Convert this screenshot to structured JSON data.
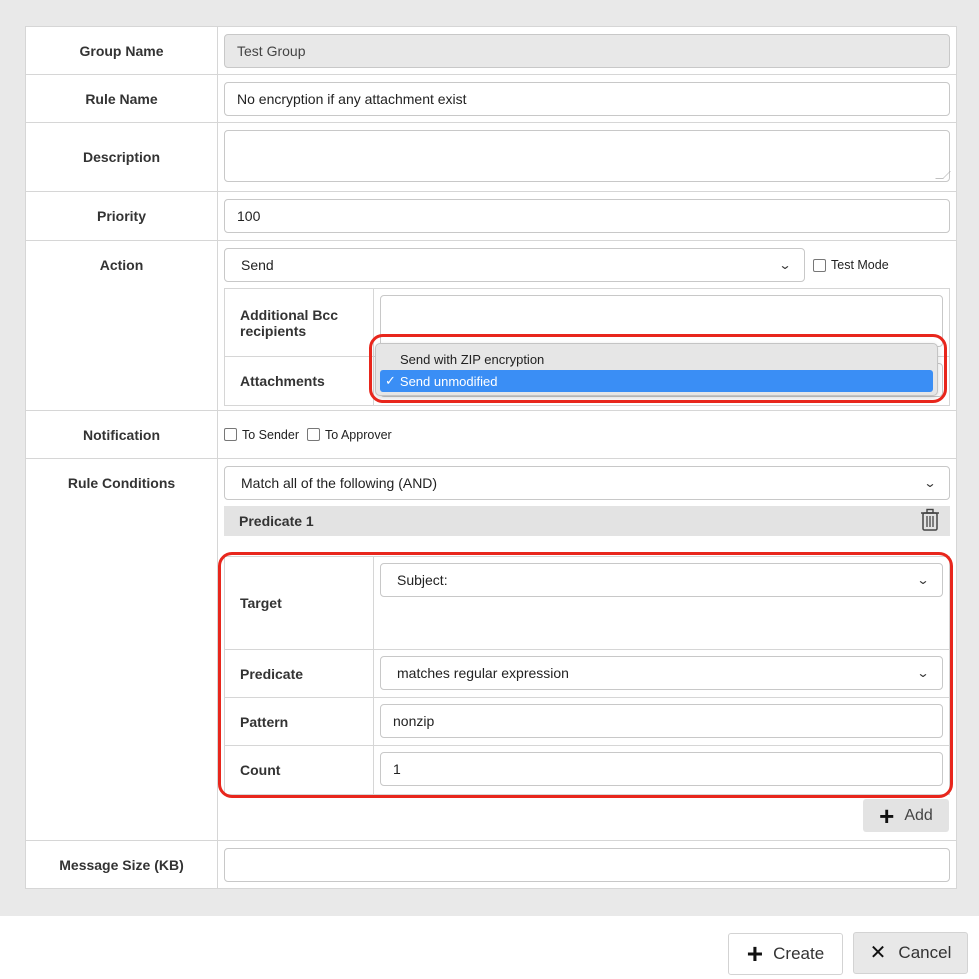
{
  "form": {
    "group_name": {
      "label": "Group Name",
      "value": "Test Group"
    },
    "rule_name": {
      "label": "Rule Name",
      "value": "No encryption if any attachment exist"
    },
    "description": {
      "label": "Description",
      "value": ""
    },
    "priority": {
      "label": "Priority",
      "value": "100"
    },
    "action": {
      "label": "Action",
      "selected": "Send",
      "test_mode_label": "Test Mode",
      "additional_bcc_label": "Additional Bcc recipients",
      "attachments_label": "Attachments",
      "attachments_options": [
        "Send with ZIP encryption",
        "Send unmodified"
      ],
      "attachments_selected": "Send unmodified",
      "check_mark": "✓"
    },
    "notification": {
      "label": "Notification",
      "to_sender": "To Sender",
      "to_approver": "To Approver"
    },
    "rule_conditions": {
      "label": "Rule Conditions",
      "match": "Match all of the following (AND)",
      "predicate_title": "Predicate 1",
      "target_label": "Target",
      "target_value": "Subject:",
      "predicate_label": "Predicate",
      "predicate_value": "matches regular expression",
      "pattern_label": "Pattern",
      "pattern_value": "nonzip",
      "count_label": "Count",
      "count_value": "1",
      "add_label": "Add"
    },
    "message_size": {
      "label": "Message Size (KB)",
      "value": ""
    }
  },
  "footer": {
    "create_label": "Create",
    "cancel_label": "Cancel"
  },
  "icons": {
    "trash": "trash-icon",
    "plus": "plus-icon",
    "close": "close-icon"
  },
  "colors": {
    "highlight": "#e8261c",
    "selected_option": "#3a8ef5"
  }
}
